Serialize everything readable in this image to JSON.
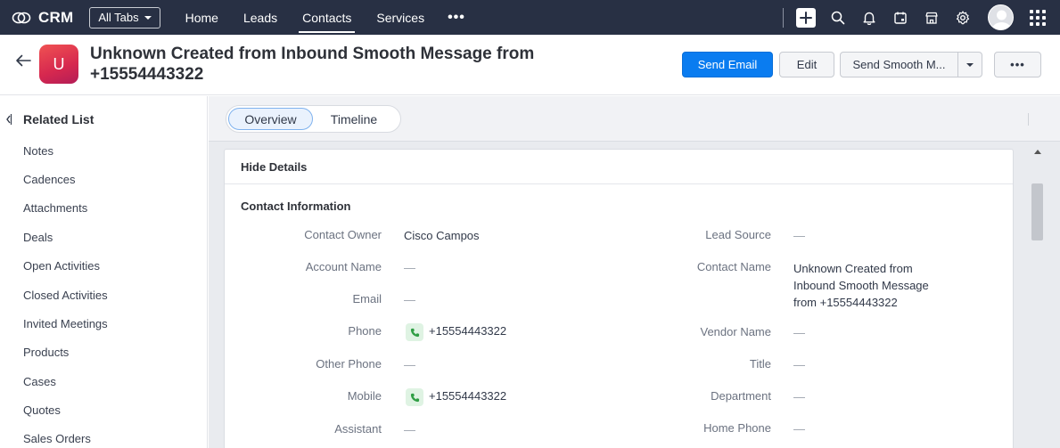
{
  "topnav": {
    "app_name": "CRM",
    "all_tabs_label": "All Tabs",
    "links": [
      "Home",
      "Leads",
      "Contacts",
      "Services"
    ],
    "active_link": "Contacts",
    "more_label": "•••",
    "icons": [
      "add-icon",
      "search-icon",
      "bell-icon",
      "calendar-icon",
      "store-icon",
      "gear-icon",
      "avatar",
      "apps-grid-icon"
    ]
  },
  "record": {
    "avatar_letter": "U",
    "title_line1": "Unknown Created from Inbound Smooth Message from",
    "title_line2": "+15554443322",
    "send_email_label": "Send Email",
    "edit_label": "Edit",
    "send_smooth_label": "Send Smooth M...",
    "more_label": "•••"
  },
  "sidebar": {
    "heading": "Related List",
    "items": [
      "Notes",
      "Cadences",
      "Attachments",
      "Deals",
      "Open Activities",
      "Closed Activities",
      "Invited Meetings",
      "Products",
      "Cases",
      "Quotes",
      "Sales Orders"
    ]
  },
  "tabs": {
    "overview": "Overview",
    "timeline": "Timeline"
  },
  "details": {
    "hide_label": "Hide Details",
    "section_title": "Contact Information",
    "left_fields": [
      {
        "label": "Contact Owner",
        "value": "Cisco Campos"
      },
      {
        "label": "Account Name",
        "value": "—"
      },
      {
        "label": "Email",
        "value": "—"
      },
      {
        "label": "Phone",
        "value": "+15554443322"
      },
      {
        "label": "Other Phone",
        "value": "—"
      },
      {
        "label": "Mobile",
        "value": "+15554443322"
      },
      {
        "label": "Assistant",
        "value": "—"
      }
    ],
    "right_fields": [
      {
        "label": "Lead Source",
        "value": "—"
      },
      {
        "label": "Contact Name",
        "value_lines": [
          "Unknown Created from",
          "Inbound Smooth Message",
          "from +15554443322"
        ]
      },
      {
        "label": "Vendor Name",
        "value": "—"
      },
      {
        "label": "Title",
        "value": "—"
      },
      {
        "label": "Department",
        "value": "—"
      },
      {
        "label": "Home Phone",
        "value": "—"
      }
    ]
  },
  "colors": {
    "nav_bg": "#283044",
    "primary": "#0a7cf0",
    "phone_icon_bg": "#dff3e3",
    "phone_icon_fg": "#2f9e44"
  }
}
